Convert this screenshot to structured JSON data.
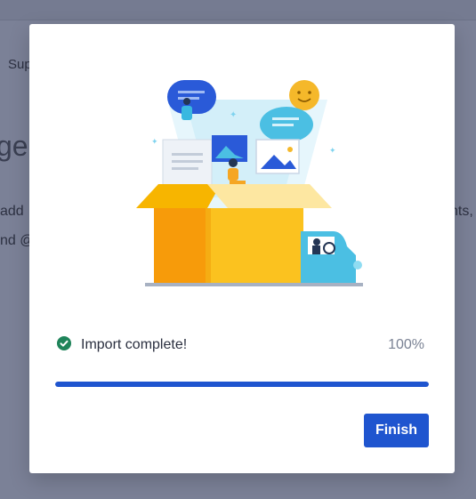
{
  "background": {
    "nav_text": "Sup",
    "heading_fragment": "ge",
    "line1_fragment": "add",
    "line2_fragment": "nd @",
    "right_fragment": "nts,"
  },
  "modal": {
    "status": {
      "icon": "check-circle-icon",
      "label": "Import complete!",
      "percent_label": "100%",
      "progress": 1.0
    },
    "finish_label": "Finish"
  },
  "colors": {
    "primary": "#1f55cf",
    "success": "#1f845a",
    "truck_yellow": "#f5b500",
    "truck_cab": "#4bbfe3"
  }
}
